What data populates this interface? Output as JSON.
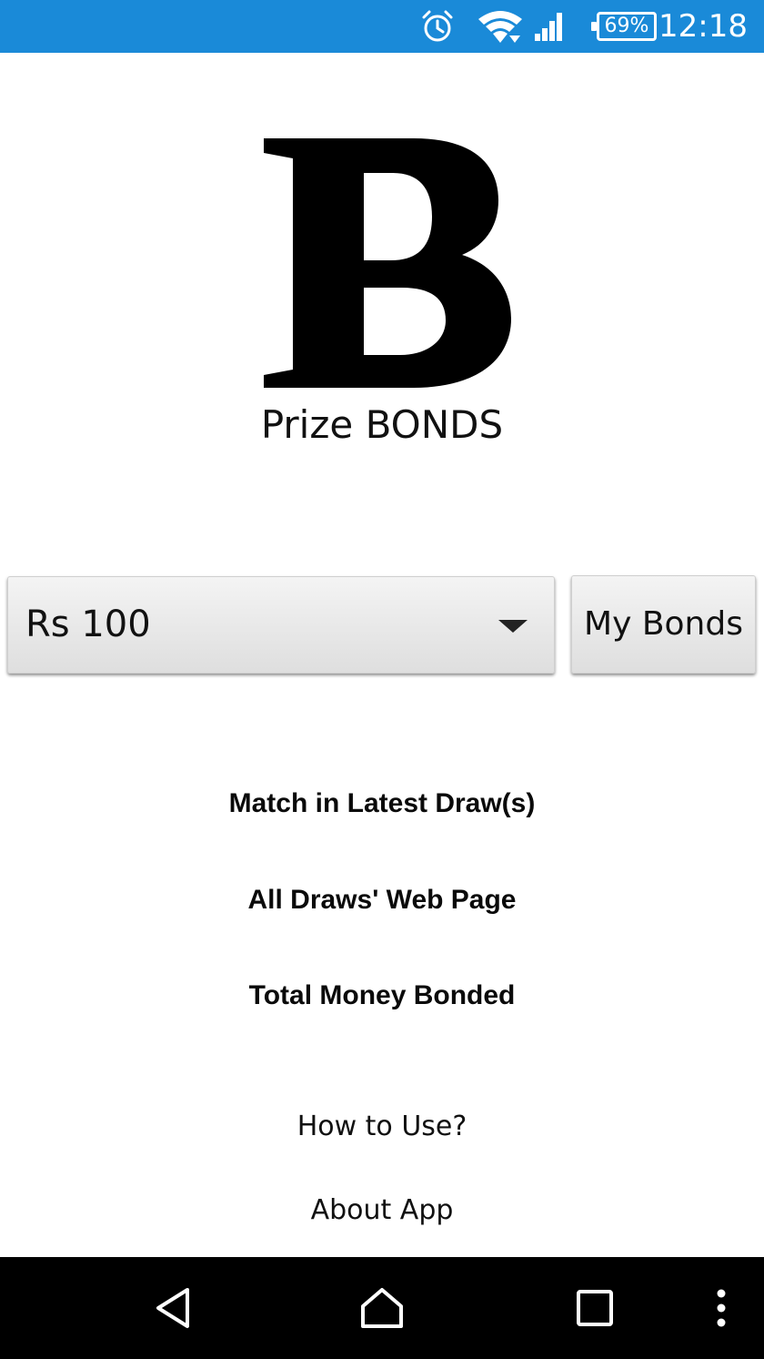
{
  "status_bar": {
    "time": "12:18",
    "battery_percent": "69%",
    "icons": [
      "alarm-icon",
      "wifi-icon",
      "cellular-signal-icon",
      "battery-icon"
    ],
    "background_color": "#1a8ad8"
  },
  "logo": {
    "letter": "B",
    "caption": "Prize BONDS"
  },
  "controls": {
    "denomination_selected": "Rs 100",
    "my_bonds_label": "My Bonds"
  },
  "menu": {
    "match_latest": "Match in Latest Draw(s)",
    "all_draws": "All Draws' Web Page",
    "total_money": "Total Money Bonded",
    "how_to_use": "How to Use?",
    "about_app": "About App"
  },
  "nav_bar": {
    "icons": [
      "back-icon",
      "home-icon",
      "recents-icon",
      "more-options-icon"
    ]
  }
}
